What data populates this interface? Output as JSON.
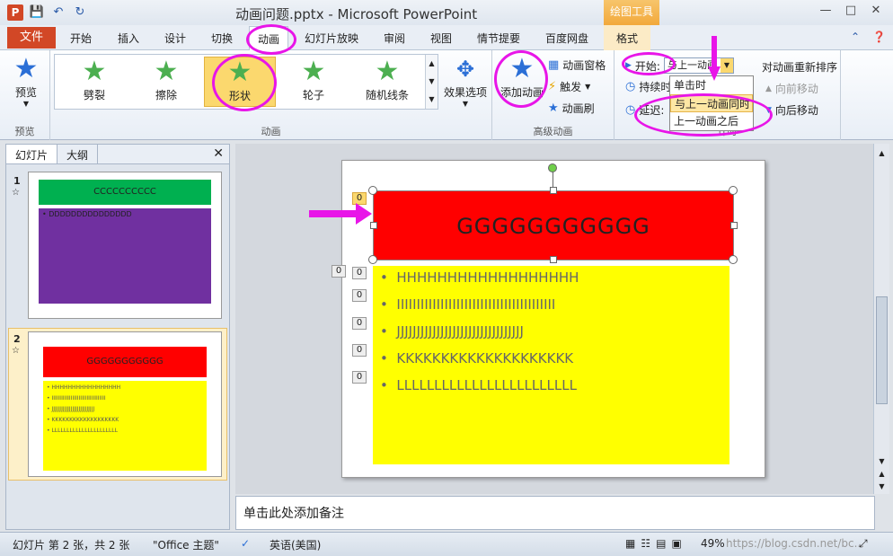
{
  "titlebar": {
    "app_icon": "P",
    "title": "动画问题.pptx - Microsoft PowerPoint",
    "drawing_tools": "绘图工具",
    "qat_icons": [
      "save-icon",
      "undo-icon",
      "redo-icon"
    ]
  },
  "tabs": {
    "file": "文件",
    "items": [
      "开始",
      "插入",
      "设计",
      "切换",
      "动画",
      "幻灯片放映",
      "审阅",
      "视图",
      "情节提要",
      "百度网盘"
    ],
    "format": "格式"
  },
  "ribbon": {
    "preview": {
      "label": "预览",
      "group": "预览"
    },
    "animation_group": "动画",
    "gallery": [
      "劈裂",
      "擦除",
      "形状",
      "轮子",
      "随机线条"
    ],
    "effect_options": "效果选项",
    "advanced": {
      "add_animation": "添加动画",
      "animation_pane": "动画窗格",
      "trigger": "触发",
      "painter": "动画刷",
      "group": "高级动画"
    },
    "timing": {
      "start_label": "开始:",
      "start_value": "与上一动画...",
      "duration_label": "持续时间:",
      "delay_label": "延迟:",
      "reorder": "对动画重新排序",
      "move_earlier": "向前移动",
      "move_later": "向后移动",
      "group": "计时"
    },
    "dropdown": [
      "单击时",
      "与上一动画同时",
      "上一动画之后"
    ]
  },
  "slide_panel": {
    "tabs": [
      "幻灯片",
      "大纲"
    ],
    "slide1": {
      "num": "1",
      "title": "CCCCCCCCCC",
      "bullet": "DDDDDDDDDDDDDDD"
    },
    "slide2": {
      "num": "2",
      "title": "GGGGGGGGGGG",
      "bullets": [
        "HHHHHHHHHHHHHHHHH",
        "IIIIIIIIIIIIIIIIIIIIIIIIIIIIIIIIII",
        "JJJJJJJJJJJJJJJJJJJJJJJJJJJ",
        "KKKKKKKKKKKKKKKKKKK",
        "LLLLLLLLLLLLLLLLLLLLLL"
      ]
    }
  },
  "slide": {
    "title": "GGGGGGGGGGG",
    "bullets": [
      "HHHHHHHHHHHHHHHHHH",
      "IIIIIIIIIIIIIIIIIIIIIIIIIIIIIIIIIIIIIIII",
      "JJJJJJJJJJJJJJJJJJJJJJJJJJJJJJJJ",
      "KKKKKKKKKKKKKKKKKKKK",
      "LLLLLLLLLLLLLLLLLLLLLLLL"
    ],
    "tags": [
      "0",
      "0",
      "0",
      "0",
      "0",
      "0",
      "0"
    ]
  },
  "notes": "单击此处添加备注",
  "statusbar": {
    "slide_info": "幻灯片 第 2 张，共 2 张",
    "theme": "\"Office 主题\"",
    "language": "英语(美国)",
    "zoom": "49%",
    "watermark": "https://blog.csdn.net/bc..."
  },
  "colors": {
    "accent": "#d24726",
    "highlight": "#fbd86e",
    "annotation": "#e815e8",
    "slide_title_bg": "#ff0000",
    "slide_body_bg": "#ffff00",
    "thumb1_title_bg": "#00b050",
    "thumb1_body_bg": "#7030a0"
  }
}
